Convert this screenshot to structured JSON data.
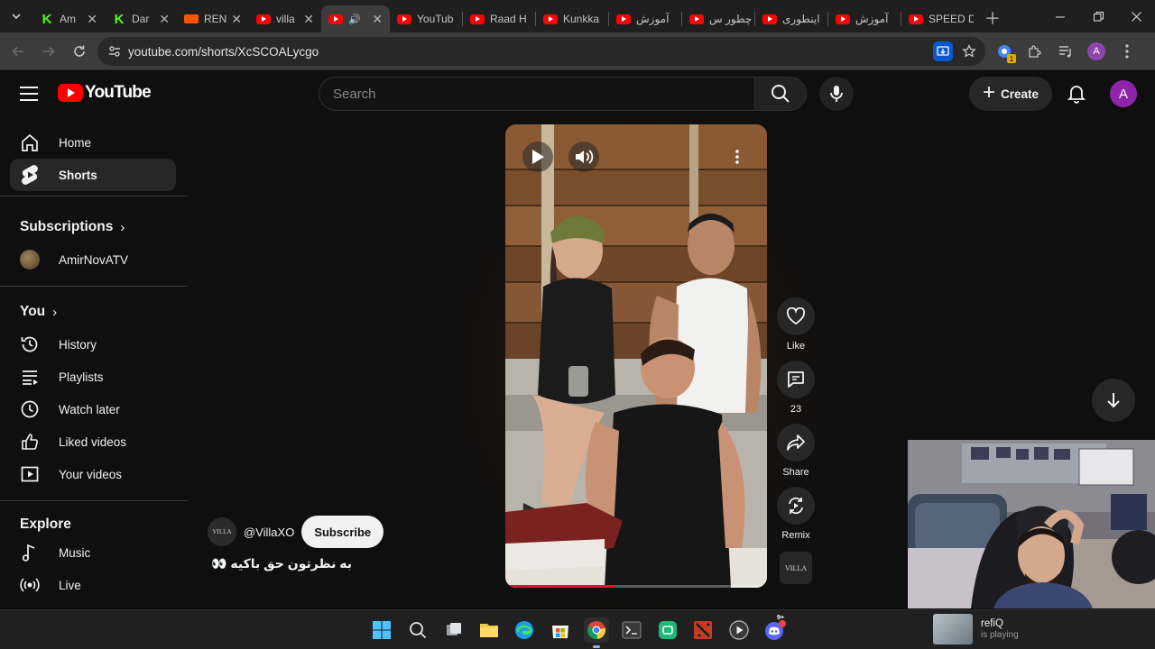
{
  "browser": {
    "tabs": [
      {
        "title": "Am",
        "favicon": "kick-icon",
        "active": false
      },
      {
        "title": "Dar",
        "favicon": "kick-icon",
        "active": false
      },
      {
        "title": "REN",
        "favicon": "soundcloud-icon",
        "active": false
      },
      {
        "title": "villa",
        "favicon": "youtube-icon",
        "active": false
      },
      {
        "title": "",
        "favicon": "youtube-icon",
        "active": true,
        "audio": true
      },
      {
        "title": "YouTub",
        "favicon": "youtube-icon",
        "active": false
      },
      {
        "title": "Raad H",
        "favicon": "youtube-icon",
        "active": false
      },
      {
        "title": "Kunkka",
        "favicon": "youtube-icon",
        "active": false
      },
      {
        "title": "آموزش",
        "favicon": "youtube-icon",
        "active": false
      },
      {
        "title": "چطور س",
        "favicon": "youtube-icon",
        "active": false
      },
      {
        "title": "اینطوری",
        "favicon": "youtube-icon",
        "active": false
      },
      {
        "title": "آموزش",
        "favicon": "youtube-icon",
        "active": false
      },
      {
        "title": "SPEED D",
        "favicon": "youtube-icon",
        "active": false
      }
    ],
    "url": "youtube.com/shorts/XcSCOALycgo",
    "profile_initial": "A"
  },
  "masthead": {
    "logo_text": "YouTube",
    "search_placeholder": "Search",
    "create_label": "Create",
    "avatar_initial": "A"
  },
  "sidebar": {
    "main": [
      {
        "label": "Home",
        "icon": "home-icon",
        "active": false
      },
      {
        "label": "Shorts",
        "icon": "shorts-icon",
        "active": true
      }
    ],
    "subscriptions_heading": "Subscriptions",
    "subscriptions": [
      {
        "label": "AmirNovATV"
      }
    ],
    "you_heading": "You",
    "you": [
      {
        "label": "History",
        "icon": "history-icon"
      },
      {
        "label": "Playlists",
        "icon": "playlists-icon"
      },
      {
        "label": "Watch later",
        "icon": "watch-later-icon"
      },
      {
        "label": "Liked videos",
        "icon": "liked-videos-icon"
      },
      {
        "label": "Your videos",
        "icon": "your-videos-icon"
      }
    ],
    "explore_heading": "Explore",
    "explore": [
      {
        "label": "Music",
        "icon": "music-icon"
      },
      {
        "label": "Live",
        "icon": "live-icon"
      }
    ]
  },
  "short": {
    "progress": 0.42,
    "channel_handle": "@VillaXO",
    "channel_avatar_text": "VILLA",
    "subscribe_label": "Subscribe",
    "caption": "به نظرتون حق باکیه 👀",
    "actions": {
      "like_label": "Like",
      "comments_count": "23",
      "share_label": "Share",
      "remix_label": "Remix",
      "sound_thumb_text": "VILLA"
    }
  },
  "taskbar": {
    "now_playing_title": "refiQ",
    "now_playing_status": "is playing",
    "discord_badge": "9+"
  },
  "colors": {
    "accent_red": "#ff0000",
    "progress_red": "#ff0033",
    "avatar_purple": "#8e24aa",
    "background": "#0f0f0f"
  }
}
